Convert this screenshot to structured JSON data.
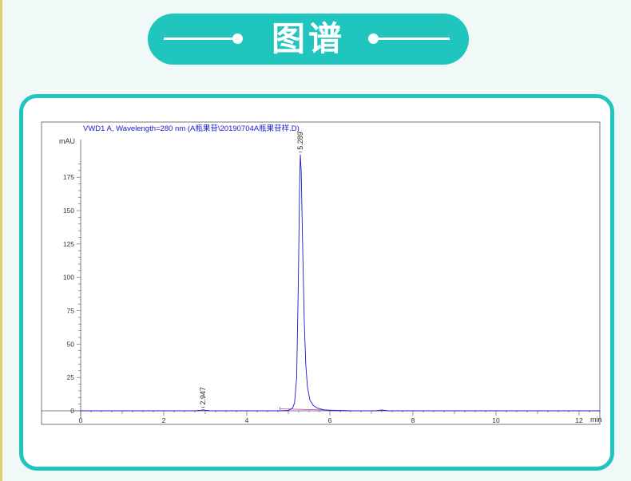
{
  "header": {
    "title": "图谱"
  },
  "colors": {
    "accent": "#20c6bd",
    "trace": "#1a1acc",
    "baseline": "#cc44cc"
  },
  "chart_data": {
    "type": "line",
    "title": "VWD1 A, Wavelength=280 nm (A瓶果苷\\20190704A瓶果苷样.D)",
    "ylabel": "mAU",
    "xlabel": "min",
    "xlim": [
      0,
      12.5
    ],
    "ylim": [
      -14,
      200
    ],
    "x_ticks": [
      0,
      2,
      4,
      6,
      8,
      10,
      12
    ],
    "y_ticks": [
      0,
      25,
      50,
      75,
      100,
      125,
      150,
      175
    ],
    "x_tick_labels": [
      "0",
      "2",
      "4",
      "6",
      "8",
      "10",
      "12"
    ],
    "y_tick_labels": [
      "0",
      "25",
      "50",
      "75",
      "100",
      "125",
      "150",
      "175"
    ],
    "grid": false,
    "peaks": [
      {
        "retention_time": 2.947,
        "label": "2.947",
        "height": 0.8
      },
      {
        "retention_time": 5.289,
        "label": "5.289",
        "height": 192
      }
    ],
    "series": [
      {
        "x": [
          0,
          2.8,
          2.9,
          2.947,
          3.0,
          3.1,
          4.8,
          5.0,
          5.1,
          5.15,
          5.2,
          5.24,
          5.27,
          5.289,
          5.31,
          5.34,
          5.38,
          5.42,
          5.46,
          5.52,
          5.6,
          5.7,
          5.85,
          6.0,
          6.5,
          7.1,
          7.25,
          7.4,
          12.5
        ],
        "y": [
          0,
          0,
          0.4,
          0.8,
          0.4,
          0,
          0,
          0.3,
          2,
          6,
          25,
          95,
          165,
          192,
          180,
          130,
          70,
          35,
          18,
          8,
          4,
          2,
          0.8,
          0.3,
          0,
          0,
          0.6,
          0,
          0
        ]
      }
    ]
  }
}
